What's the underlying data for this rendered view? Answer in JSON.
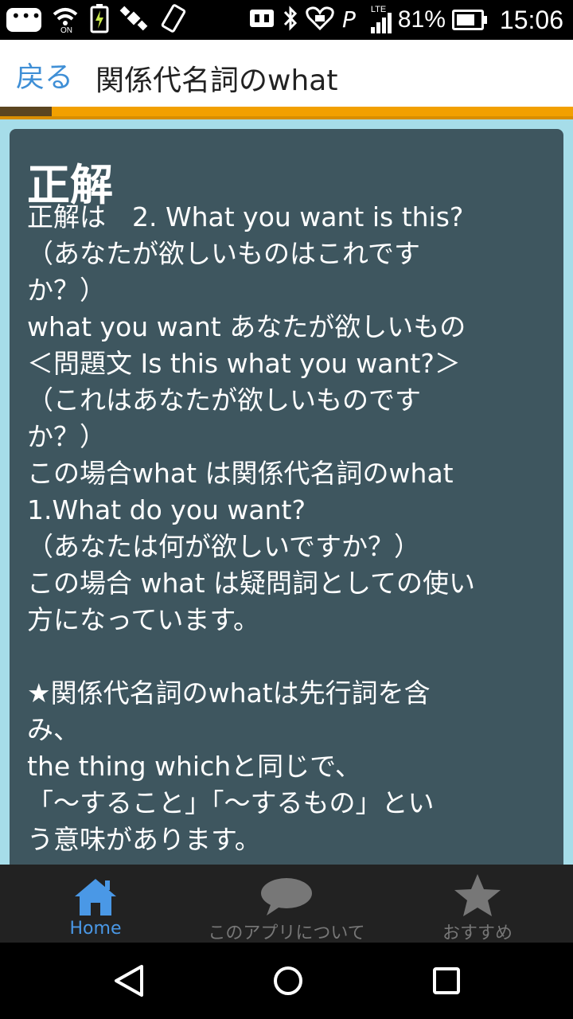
{
  "status_bar": {
    "battery_percent": "81%",
    "time": "15:06",
    "network": "LTE",
    "icons": [
      "message-icon",
      "wifi-calling-icon",
      "battery-charging-icon",
      "satellite-icon",
      "vibrate-icon",
      "nfc-icon",
      "bluetooth-icon",
      "heart-icon",
      "signal-icon"
    ]
  },
  "header": {
    "back_label": "戻る",
    "title": "関係代名詞のwhat"
  },
  "progress": {
    "fraction": 0.09
  },
  "answer_card": {
    "title": "正解",
    "lines": [
      "正解は　2. What you want is this?",
      "（あなたが欲しいものはこれです",
      "か？）",
      "what you want あなたが欲しいもの",
      "＜問題文 Is this what you want?＞",
      "（これはあなたが欲しいものです",
      "か？）",
      "この場合what は関係代名詞のwhat",
      "1.What do you want?",
      "（あなたは何が欲しいですか？）",
      "この場合 what は疑問詞としての使い",
      "方になっています。",
      "",
      "★関係代名詞のwhatは先行詞を含",
      "み、",
      "the thing whichと同じで、",
      "「～すること」「～するもの」とい",
      "う意味があります。"
    ]
  },
  "bottom_nav": {
    "items": [
      {
        "label": "Home",
        "icon": "home-icon",
        "active": true
      },
      {
        "label": "このアプリについて",
        "icon": "speech-bubble-icon",
        "active": false
      },
      {
        "label": "おすすめ",
        "icon": "star-icon",
        "active": false
      }
    ]
  },
  "system_nav": {
    "icons": [
      "back-triangle-icon",
      "home-circle-icon",
      "recents-square-icon"
    ]
  },
  "colors": {
    "accent": "#3f8fd6",
    "progress_bar": "#f2a000",
    "content_bg": "#a6dde9",
    "card_bg": "#3e565f",
    "nav_bg": "#222222",
    "nav_active": "#4a98e6"
  }
}
